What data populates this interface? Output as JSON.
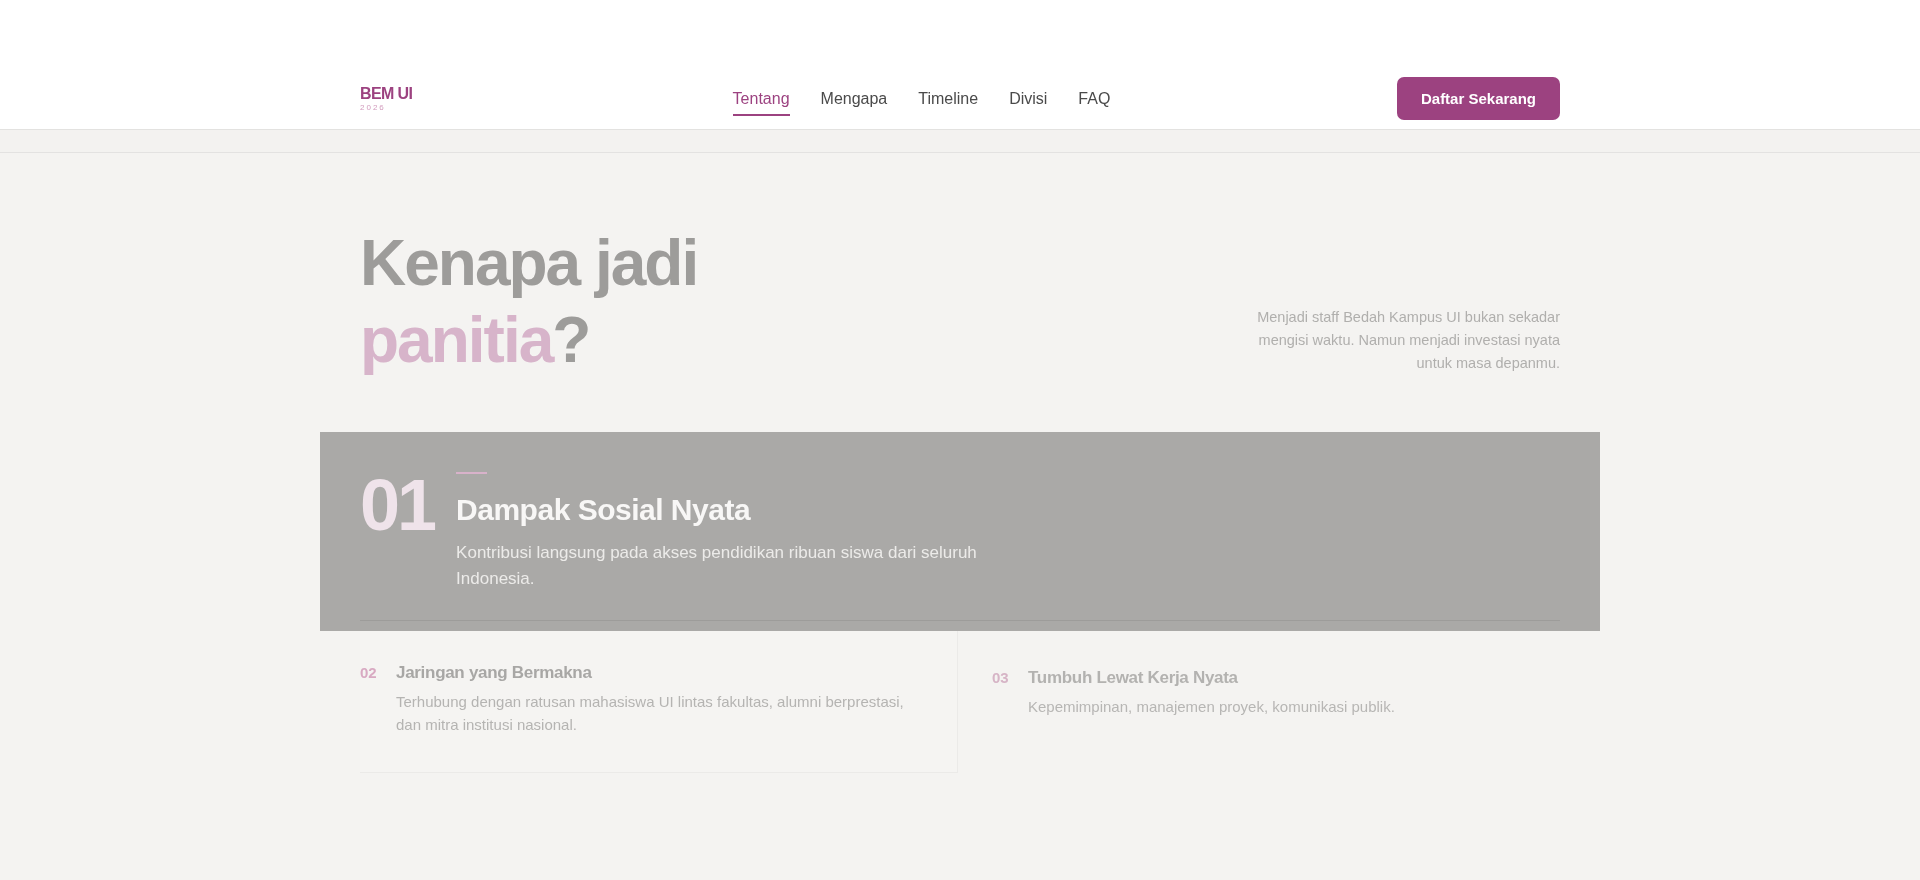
{
  "header": {
    "logo": "BEM UI",
    "logo_year": "2026",
    "nav": [
      {
        "label": "Tentang",
        "selected": true
      },
      {
        "label": "Mengapa",
        "selected": false
      },
      {
        "label": "Timeline",
        "selected": false
      },
      {
        "label": "Divisi",
        "selected": false
      },
      {
        "label": "FAQ",
        "selected": false
      }
    ],
    "cta": "Daftar Sekarang"
  },
  "intro": {
    "heading_line1": "Kenapa jadi",
    "heading_accent": "panitia",
    "heading_end": "?",
    "description": "Menjadi staff Bedah Kampus UI bukan sekadar mengisi waktu. Namun menjadi investasi nyata untuk masa depanmu."
  },
  "reasons": [
    {
      "kind": "featured",
      "number": "01",
      "title": "Dampak Sosial Nyata",
      "description": "Kontribusi langsung pada akses pendidikan ribuan siswa dari seluruh Indonesia."
    },
    {
      "kind": "card",
      "number": "02",
      "title": "Jaringan yang Bermakna",
      "description": "Terhubung dengan ratusan mahasiswa UI lintas fakultas, alumni berprestasi, dan mitra institusi nasional."
    },
    {
      "kind": "faded",
      "number": "03",
      "title": "Tumbuh Lewat Kerja Nyata",
      "description": "Kepemimpinan, manajemen proyek, komunikasi publik."
    }
  ]
}
